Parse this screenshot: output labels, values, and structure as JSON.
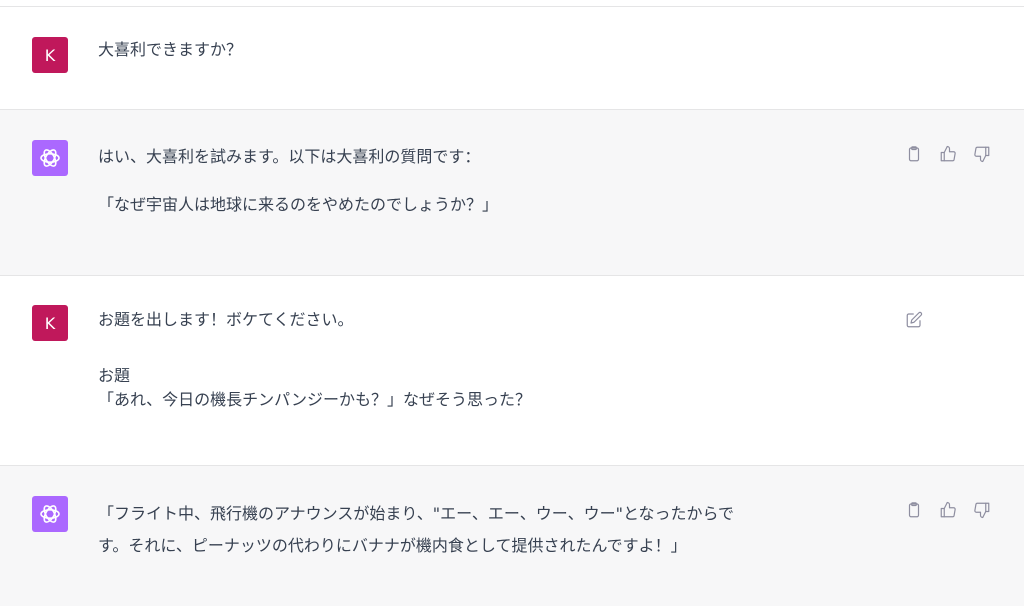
{
  "conversation": {
    "messages": [
      {
        "role": "user",
        "avatar_letter": "K",
        "lines": [
          "大喜利できますか？"
        ]
      },
      {
        "role": "assistant",
        "lines": [
          "はい、大喜利を試みます。以下は大喜利の質問です：",
          "「なぜ宇宙人は地球に来るのをやめたのでしょうか？」"
        ]
      },
      {
        "role": "user",
        "avatar_letter": "K",
        "lines": [
          "お題を出します！ボケてください。",
          "お題",
          "「あれ、今日の機長チンパンジーかも？」なぜそう思った？"
        ]
      },
      {
        "role": "assistant",
        "lines": [
          "「フライト中、飛行機のアナウンスが始まり、\"エー、エー、ウー、ウー\"となったからで",
          "す。それに、ピーナッツの代わりにバナナが機内食として提供されたんですよ！」"
        ]
      }
    ]
  },
  "icons": {
    "copy": "clipboard-icon",
    "like": "thumbs-up-icon",
    "dislike": "thumbs-down-icon",
    "edit": "edit-icon",
    "assistant_logo": "openai-logo-icon"
  },
  "colors": {
    "user_avatar_bg": "#c0185b",
    "assistant_avatar_bg": "#ab68ff",
    "assistant_row_bg": "#f7f7f8",
    "text": "#374151",
    "icon": "#8e8ea0"
  }
}
